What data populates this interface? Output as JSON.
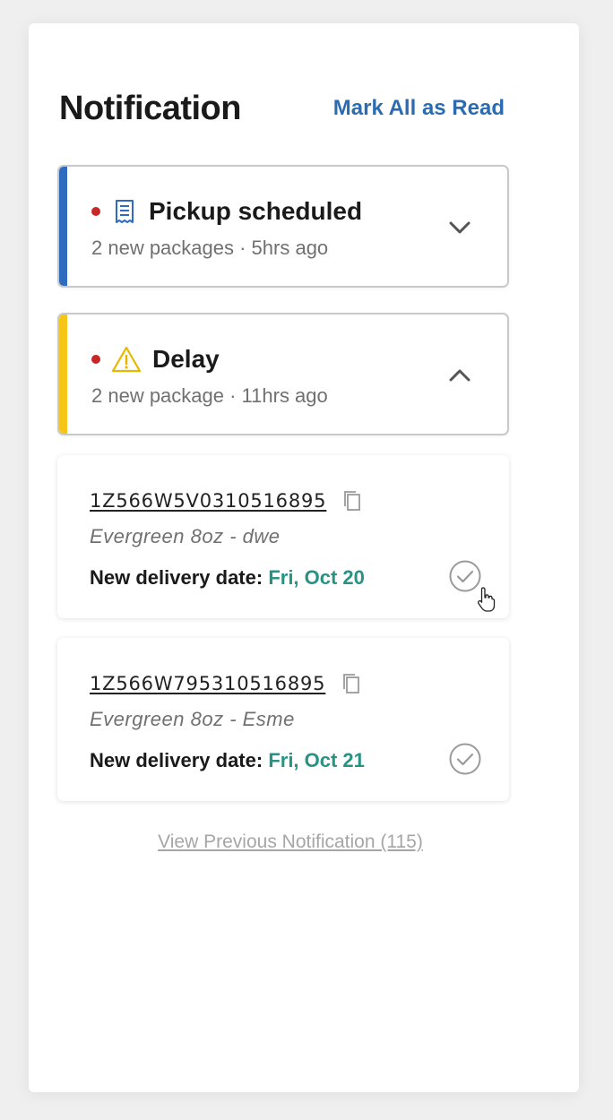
{
  "header": {
    "title": "Notification",
    "mark_all_label": "Mark All as Read"
  },
  "groups": [
    {
      "title": "Pickup scheduled",
      "subtitle": "2 new packages · 5hrs ago",
      "accent_color": "#2f6bbf",
      "icon": "receipt-icon",
      "expanded": false
    },
    {
      "title": "Delay",
      "subtitle": "2 new package · 11hrs ago",
      "accent_color": "#f5c518",
      "icon": "warning-icon",
      "expanded": true
    }
  ],
  "packages": [
    {
      "tracking": "1Z566W5V0310516895",
      "product": "Evergreen 8oz - dwe",
      "delivery_label": "New delivery date:",
      "delivery_date": "Fri, Oct 20"
    },
    {
      "tracking": "1Z566W795310516895",
      "product": "Evergreen 8oz - Esme",
      "delivery_label": "New delivery date:",
      "delivery_date": "Fri, Oct 21"
    }
  ],
  "footer": {
    "view_previous_label": "View Previous Notification (115)"
  },
  "colors": {
    "unread_dot": "#c62828",
    "link_blue": "#2b6cb0",
    "date_teal": "#2a9283"
  }
}
